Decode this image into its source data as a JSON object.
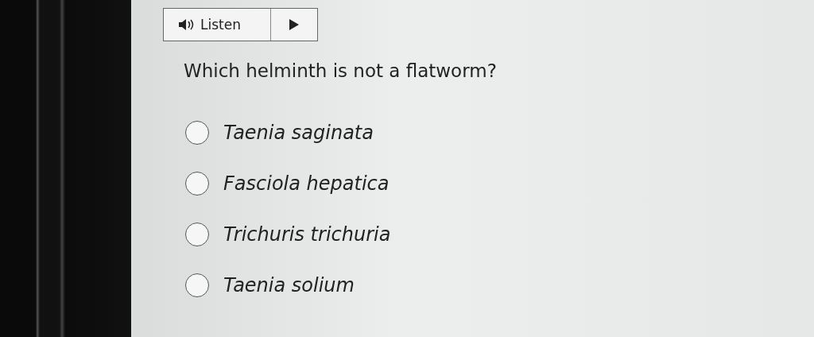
{
  "listen_button": {
    "label": "Listen"
  },
  "question": "Which helminth is not a flatworm?",
  "options": [
    {
      "label": "Taenia saginata",
      "selected": false
    },
    {
      "label": "Fasciola hepatica",
      "selected": false
    },
    {
      "label": "Trichuris trichuria",
      "selected": false
    },
    {
      "label": "Taenia solium",
      "selected": false
    }
  ]
}
